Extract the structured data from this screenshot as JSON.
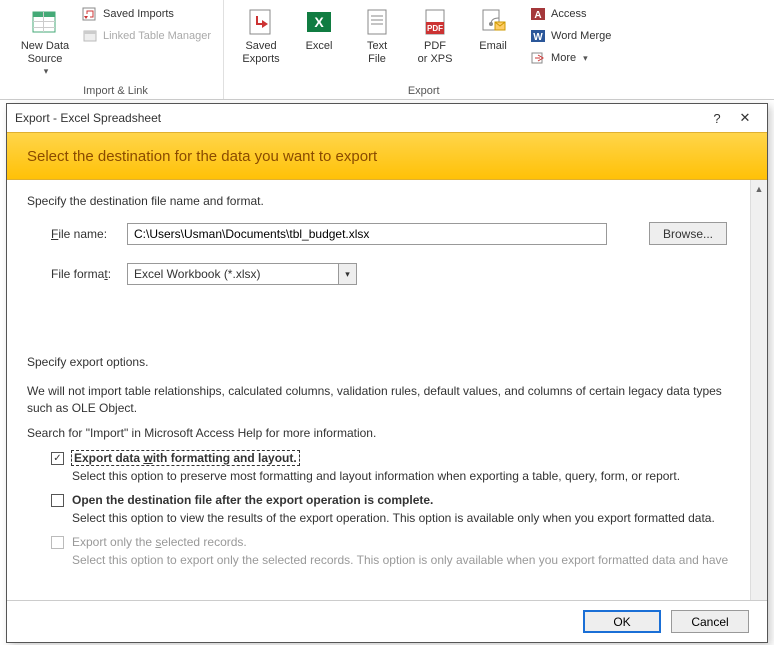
{
  "ribbon": {
    "import_link": {
      "new_data_source": "New Data\nSource",
      "saved_imports": "Saved Imports",
      "linked_table_manager": "Linked Table Manager",
      "group_label": "Import & Link"
    },
    "export": {
      "saved_exports": "Saved\nExports",
      "excel": "Excel",
      "text_file": "Text\nFile",
      "pdf_xps": "PDF\nor XPS",
      "email": "Email",
      "access": "Access",
      "word_merge": "Word Merge",
      "more": "More",
      "group_label": "Export"
    }
  },
  "dialog": {
    "title": "Export - Excel Spreadsheet",
    "help": "?",
    "close": "✕",
    "banner": "Select the destination for the data you want to export",
    "spec_dest": "Specify the destination file name and format.",
    "file_name_label": "File name:",
    "file_name_value": "C:\\Users\\Usman\\Documents\\tbl_budget.xlsx",
    "browse": "Browse...",
    "file_format_label": "File format:",
    "file_format_value": "Excel Workbook (*.xlsx)",
    "spec_opts": "Specify export options.",
    "import_note": "We will not import table relationships, calculated columns, validation rules, default values, and columns of certain legacy data types such as OLE Object.",
    "help_note": "Search for \"Import\" in Microsoft Access Help for more information.",
    "opt1_title": "Export data with formatting and layout.",
    "opt1_desc": "Select this option to preserve most formatting and layout information when exporting a table, query, form, or report.",
    "opt2_title": "Open the destination file after the export operation is complete.",
    "opt2_desc": "Select this option to view the results of the export operation. This option is available only when you export formatted data.",
    "opt3_title": "Export only the selected records.",
    "opt3_desc": "Select this option to export only the selected records. This option is only available when you export formatted data and have",
    "ok": "OK",
    "cancel": "Cancel"
  }
}
